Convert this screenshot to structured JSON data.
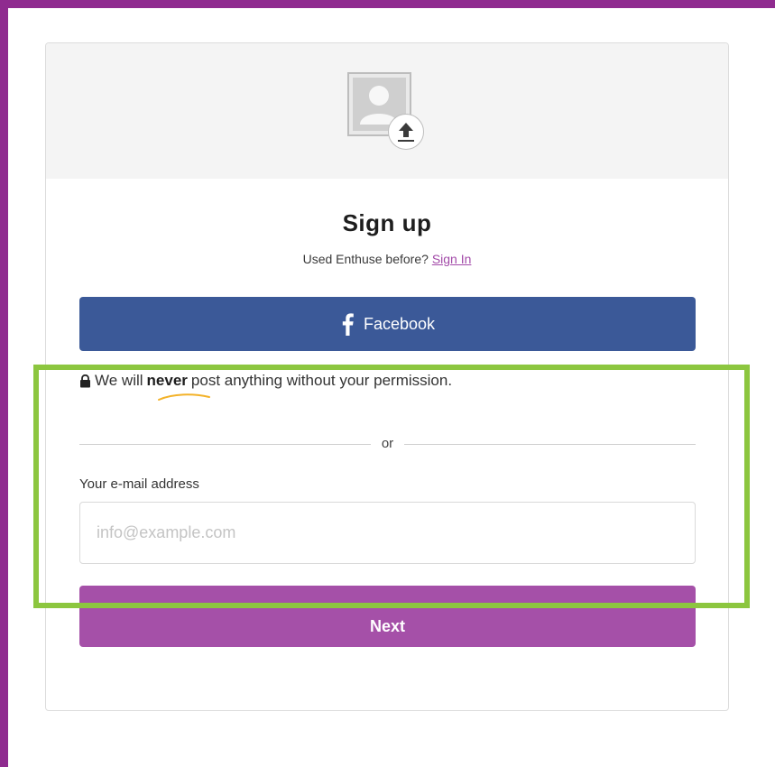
{
  "colors": {
    "frame": "#8f2b8f",
    "facebook": "#3b5998",
    "next": "#a550a8",
    "link": "#a24aa8",
    "highlight": "#8cc63f",
    "swoosh": "#f3b229"
  },
  "header": {
    "avatar_icon": "user-upload-icon",
    "upload_icon": "upload-arrow-icon"
  },
  "signup": {
    "title": "Sign up",
    "subtitle_prefix": "Used Enthuse before?",
    "sign_in_link": "Sign In"
  },
  "facebook": {
    "icon": "facebook-icon",
    "label": "Facebook"
  },
  "permission": {
    "icon": "lock-icon",
    "text_before": "We will",
    "emphasis": "never",
    "text_after": "post anything without your permission."
  },
  "divider": {
    "label": "or"
  },
  "email": {
    "label": "Your e-mail address",
    "placeholder": "info@example.com",
    "value": ""
  },
  "next": {
    "label": "Next"
  }
}
